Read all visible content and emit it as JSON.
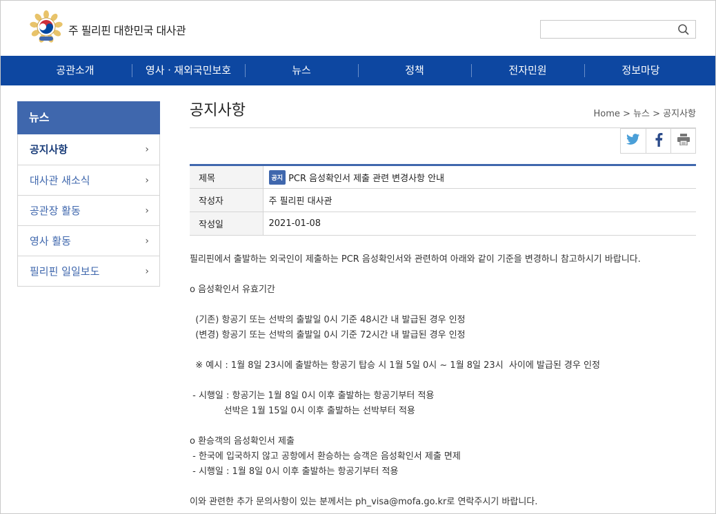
{
  "header": {
    "site_title": "주 필리핀 대한민국 대사관",
    "search_placeholder": "",
    "search_icon": "search-icon"
  },
  "gnb": {
    "items": [
      "공관소개",
      "영사ㆍ재외국민보호",
      "뉴스",
      "정책",
      "전자민원",
      "정보마당"
    ]
  },
  "lnb": {
    "title": "뉴스",
    "items": [
      "공지사항",
      "대사관 새소식",
      "공관장 활동",
      "영사 활동",
      "필리핀 일일보도"
    ]
  },
  "page": {
    "title": "공지사항",
    "breadcrumb": [
      "Home",
      "뉴스",
      "공지사항"
    ]
  },
  "share": {
    "icons": [
      "twitter-icon",
      "facebook-icon",
      "print-icon"
    ]
  },
  "article": {
    "subject_label": "제목",
    "badge": "공지",
    "subject": "PCR 음성확인서 제출 관련 변경사항 안내",
    "author_label": "작성자",
    "author": "주 필리핀 대사관",
    "date_label": "작성일",
    "date": "2021-01-08",
    "lines": [
      "필리핀에서 출발하는 외국인이 제출하는 PCR 음성확인서와 관련하여 아래와 같이 기준을 변경하니 참고하시기 바랍니다.",
      "",
      "o 음성확인서 유효기간",
      "",
      "  (기존) 항공기 또는 선박의 출발일 0시 기준 48시간 내 발급된 경우 인정",
      "  (변경) 항공기 또는 선박의 출발일 0시 기준 72시간 내 발급된 경우 인정",
      "",
      "  ※ 예시 : 1월 8일 23시에 출발하는 항공기 탑승 시 1월 5일 0시 ~ 1월 8일 23시  사이에 발급된 경우 인정",
      "",
      " - 시행일 : 항공기는 1월 8일 0시 이후 출발하는 항공기부터 적용",
      "            선박은 1월 15일 0시 이후 출발하는 선박부터 적용",
      "",
      "o 환승객의 음성확인서 제출",
      " - 한국에 입국하지 않고 공항에서 환승하는 승객은 음성확인서 제출 면제",
      " - 시행일 : 1월 8일 0시 이후 출발하는 항공기부터 적용",
      "",
      "이와 관련한 추가 문의사항이 있는 분께서는 ph_visa@mofa.go.kr로 연락주시기 바랍니다."
    ]
  },
  "colors": {
    "gnb_bg": "#0d47a1",
    "accent": "#3f67ad"
  }
}
